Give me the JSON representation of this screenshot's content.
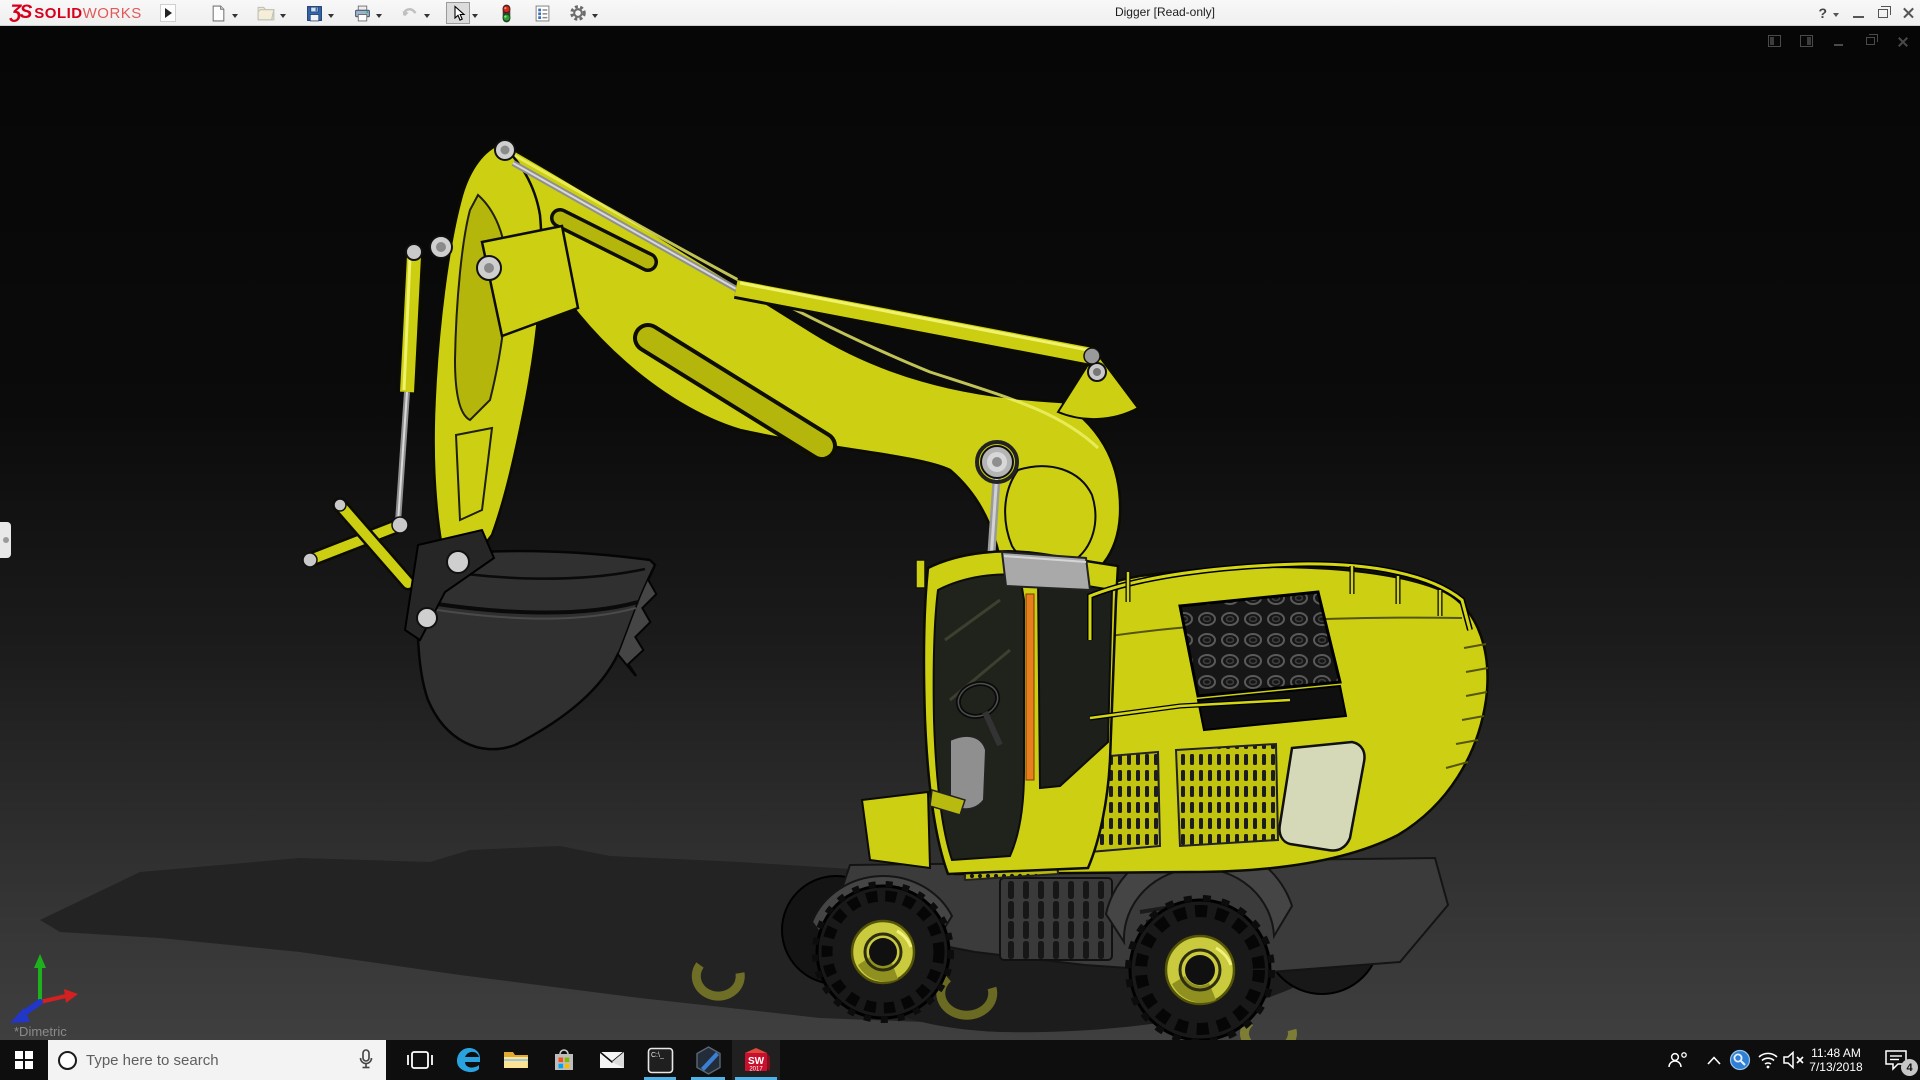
{
  "titlebar": {
    "logo": {
      "glyph": "ƷS",
      "solid": "SOLID",
      "works": "WORKS"
    },
    "title": "Digger [Read-only]",
    "help_label": "?",
    "tools": [
      "new-document",
      "open",
      "save",
      "print",
      "undo",
      "select",
      "rebuild",
      "file-properties",
      "options"
    ],
    "window_controls": [
      "help",
      "minimize",
      "restore",
      "close"
    ]
  },
  "viewport": {
    "orientation": "*Dimetric",
    "model": "Digger excavator 3D model",
    "window_controls": [
      "pane-left",
      "pane-right",
      "minimize",
      "restore",
      "close"
    ],
    "triad_axes": [
      "x",
      "y",
      "z"
    ],
    "colors": {
      "body_yellow": "#cdd012",
      "bucket_gray": "#303030",
      "orange_stripe": "#e87f1e",
      "background_top": "#060606",
      "background_bottom": "#3e3e3e"
    }
  },
  "taskbar": {
    "search": {
      "placeholder": "Type here to search"
    },
    "apps": [
      "task-view",
      "edge",
      "file-explorer",
      "store",
      "mail",
      "command-prompt",
      "composer",
      "solidworks-2017"
    ],
    "cmd_icon_text": "C:\\_",
    "sw_icon": {
      "line1": "SW",
      "line2": "2017"
    },
    "running_apps": [
      "command-prompt",
      "composer",
      "solidworks-2017"
    ],
    "accent_underline": "#4fb3e8",
    "tray": {
      "icons": [
        "people",
        "hidden-icons-chevron",
        "resource-monitor",
        "wifi",
        "volume-muted",
        "action-center"
      ],
      "time": "11:48 AM",
      "date": "7/13/2018",
      "notification_count": "4"
    }
  }
}
